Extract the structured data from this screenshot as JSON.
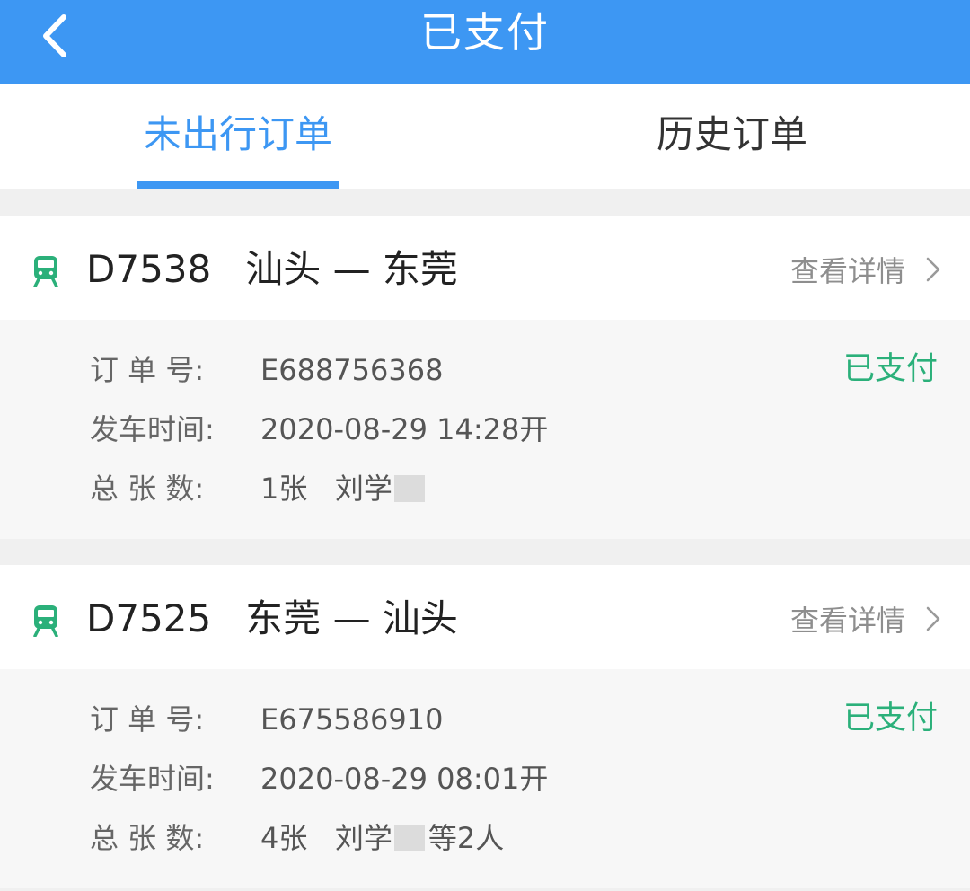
{
  "header": {
    "title": "已支付",
    "back_icon": "chevron-left-icon"
  },
  "tabs": [
    {
      "label": "未出行订单",
      "active": true
    },
    {
      "label": "历史订单",
      "active": false
    }
  ],
  "colors": {
    "accent": "#3d97f3",
    "paid": "#2bb07a",
    "train_icon": "#2bb07a"
  },
  "orders": [
    {
      "train_no": "D7538",
      "route": "汕头 — 东莞",
      "detail_label": "查看详情",
      "status": "已支付",
      "order_label": "订 单 号:",
      "order_no": "E688756368",
      "depart_label": "发车时间:",
      "depart_time": "2020-08-29   14:28开",
      "count_label": "总 张 数:",
      "count": "1张",
      "passenger": "刘学",
      "passenger_extra": ""
    },
    {
      "train_no": "D7525",
      "route": "东莞 — 汕头",
      "detail_label": "查看详情",
      "status": "已支付",
      "order_label": "订 单 号:",
      "order_no": "E675586910",
      "depart_label": "发车时间:",
      "depart_time": "2020-08-29   08:01开",
      "count_label": "总 张 数:",
      "count": "4张",
      "passenger": "刘学",
      "passenger_extra": "等2人"
    }
  ]
}
